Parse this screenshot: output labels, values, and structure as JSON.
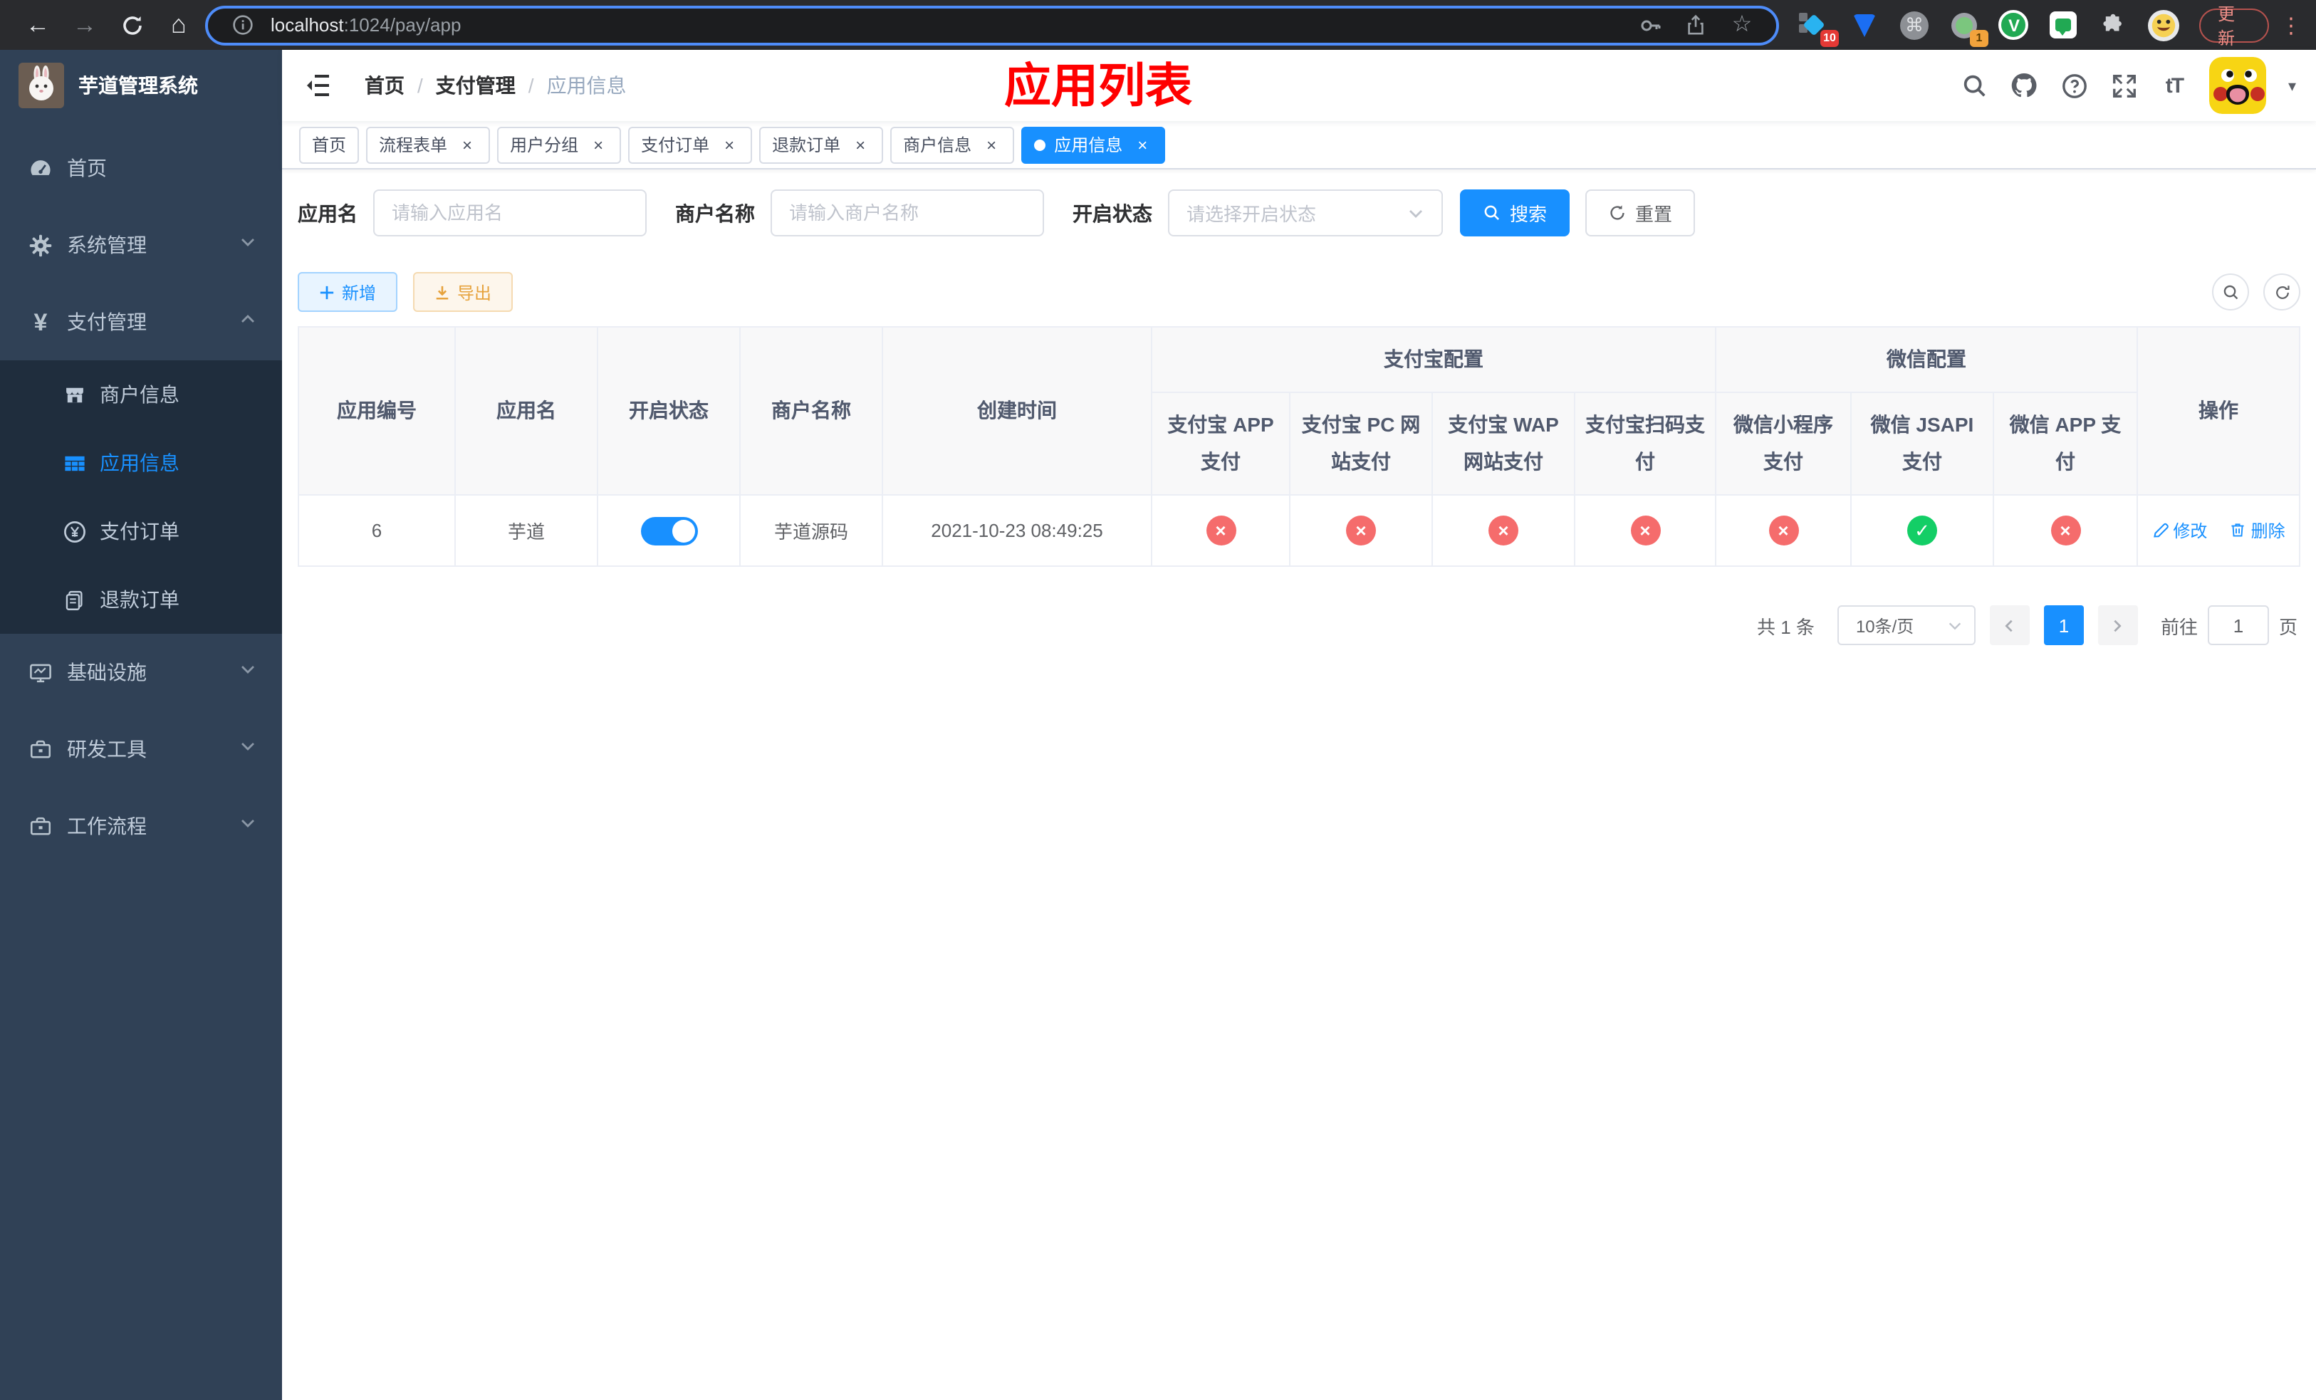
{
  "colors": {
    "primary": "#1890ff",
    "danger": "#f56c6c",
    "success": "#13ce66",
    "warning": "#e6a23c",
    "title_red": "#ff0000",
    "sidebar_bg": "#304156",
    "submenu_bg": "#1f2d3d"
  },
  "browser": {
    "url_host": "localhost",
    "url_path": ":1024/pay/app",
    "ext_badge_blue": "10",
    "ext_badge_green": "1",
    "cmd_glyph": "⌘",
    "v_glyph": "V",
    "update_label": "更新",
    "dots_glyph": "⋮",
    "star_glyph": "☆",
    "back_glyph": "←",
    "forward_glyph": "→",
    "home_glyph": "⌂"
  },
  "sidebar": {
    "logo_title": "芋道管理系统",
    "menu": [
      {
        "label": "首页"
      },
      {
        "label": "系统管理"
      },
      {
        "label": "支付管理"
      },
      {
        "label": "基础设施"
      },
      {
        "label": "研发工具"
      },
      {
        "label": "工作流程"
      }
    ],
    "submenu": [
      {
        "label": "商户信息"
      },
      {
        "label": "应用信息"
      },
      {
        "label": "支付订单"
      },
      {
        "label": "退款订单"
      }
    ],
    "yen_glyph": "¥"
  },
  "navbar": {
    "breadcrumb": [
      "首页",
      "支付管理",
      "应用信息"
    ],
    "breadcrumb_sep": "/",
    "page_title": "应用列表",
    "font_size_glyph": "tT",
    "caret_glyph": "▾"
  },
  "tabs": [
    {
      "label": "首页"
    },
    {
      "label": "流程表单",
      "close": "×"
    },
    {
      "label": "用户分组",
      "close": "×"
    },
    {
      "label": "支付订单",
      "close": "×"
    },
    {
      "label": "退款订单",
      "close": "×"
    },
    {
      "label": "商户信息",
      "close": "×"
    },
    {
      "label": "应用信息",
      "close": "×"
    }
  ],
  "search_form": {
    "app_name_label": "应用名",
    "app_name_placeholder": "请输入应用名",
    "merchant_label": "商户名称",
    "merchant_placeholder": "请输入商户名称",
    "status_label": "开启状态",
    "status_placeholder": "请选择开启状态",
    "search_label": "搜索",
    "reset_label": "重置"
  },
  "toolbar": {
    "add_label": "新增",
    "export_label": "导出"
  },
  "table": {
    "columns": {
      "id": "应用编号",
      "name": "应用名",
      "enabled": "开启状态",
      "merchant": "商户名称",
      "created": "创建时间",
      "op": "操作"
    },
    "group_alipay": "支付宝配置",
    "group_wechat": "微信配置",
    "alipay_cols": [
      "支付宝 APP 支付",
      "支付宝 PC 网站支付",
      "支付宝 WAP 网站支付",
      "支付宝扫码支付"
    ],
    "wechat_cols": [
      "微信小程序支付",
      "微信 JSAPI 支付",
      "微信 APP 支付"
    ],
    "edit_label": "修改",
    "delete_label": "删除",
    "rows": [
      {
        "id": "6",
        "name": "芋道",
        "enabled": "on",
        "merchant": "芋道源码",
        "created": "2021-10-23 08:49:25",
        "configs": [
          {
            "name": "alipay-app-pay",
            "state": "off",
            "glyph": "×"
          },
          {
            "name": "alipay-pc-pay",
            "state": "off",
            "glyph": "×"
          },
          {
            "name": "alipay-wap-pay",
            "state": "off",
            "glyph": "×"
          },
          {
            "name": "alipay-scan-pay",
            "state": "off",
            "glyph": "×"
          },
          {
            "name": "wechat-lite-pay",
            "state": "off",
            "glyph": "×"
          },
          {
            "name": "wechat-jsapi-pay",
            "state": "on",
            "glyph": "✓"
          },
          {
            "name": "wechat-app-pay",
            "state": "off",
            "glyph": "×"
          }
        ]
      }
    ]
  },
  "pagination": {
    "total_text": "共 1 条",
    "page_size": "10条/页",
    "current_page": "1",
    "goto_label": "前往",
    "goto_value": "1",
    "page_unit": "页"
  }
}
